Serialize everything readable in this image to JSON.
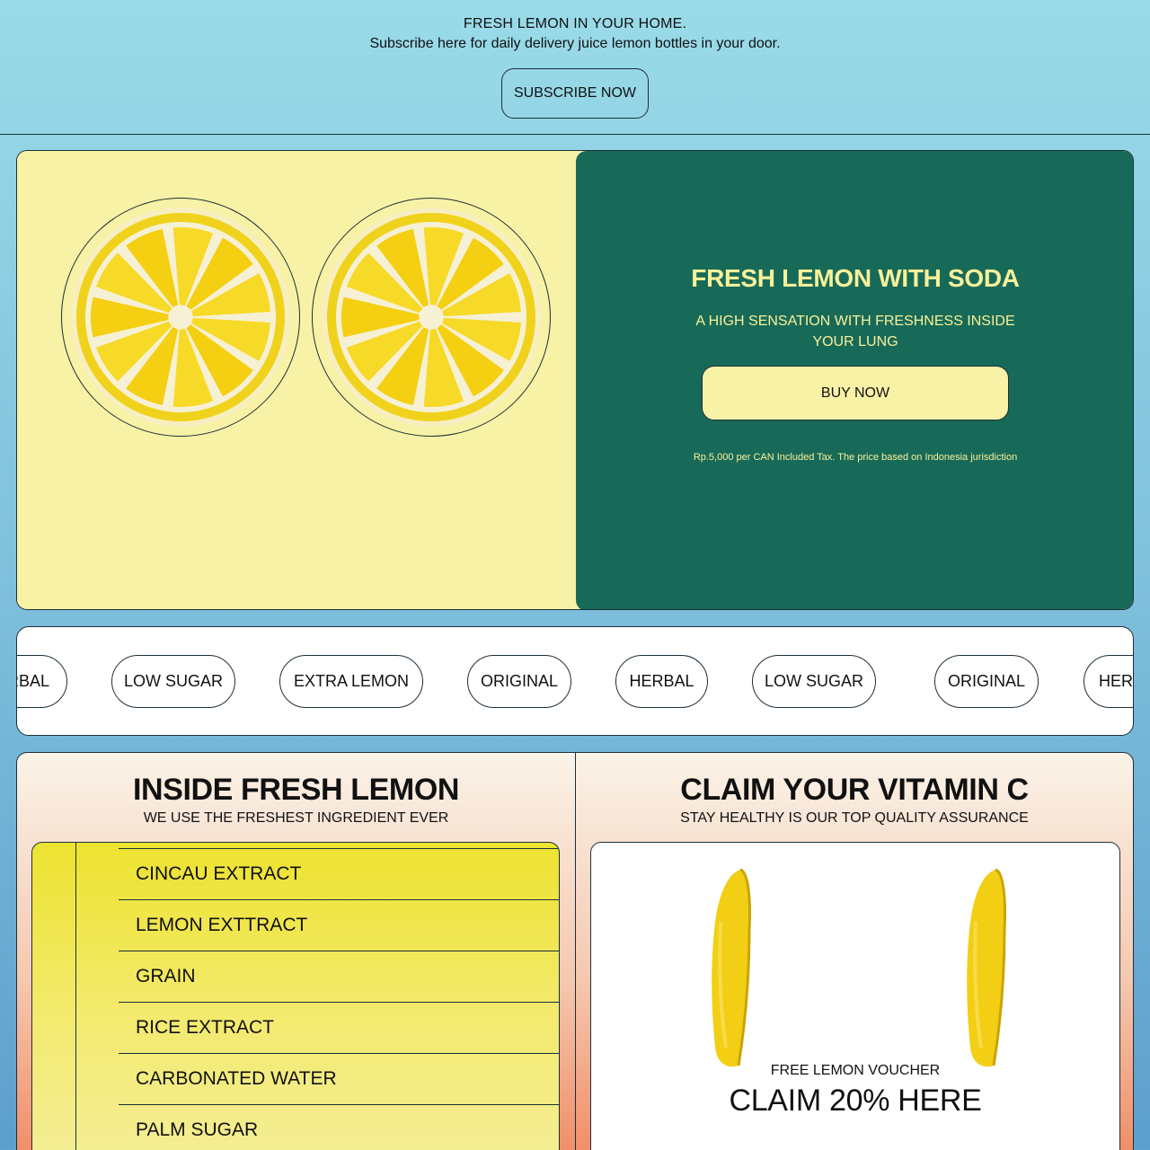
{
  "banner": {
    "headline": "FRESH LEMON IN YOUR HOME.",
    "subtext": "Subscribe here for daily delivery juice lemon bottles in your door.",
    "button_label": "SUBSCRIBE NOW"
  },
  "hero": {
    "title": "FRESH LEMON WITH SODA",
    "subtitle": "A HIGH SENSATION WITH FRESHNESS INSIDE YOUR LUNG",
    "button_label": "BUY NOW",
    "price_note": "Rp.5,000 per CAN Included Tax. The price based on Indonesia jurisdiction",
    "accent_color": "#186a58",
    "highlight_color": "#f8f09a"
  },
  "flavors": {
    "chips": [
      {
        "label": "HERBAL"
      },
      {
        "label": "LOW SUGAR"
      },
      {
        "label": "EXTRA LEMON"
      },
      {
        "label": "ORIGINAL"
      },
      {
        "label": "HERBAL"
      },
      {
        "label": "LOW SUGAR"
      },
      {
        "label": "ORIGINAL"
      },
      {
        "label": "HERBAL"
      }
    ]
  },
  "ingredients_panel": {
    "title": "INSIDE FRESH LEMON",
    "subtitle": "WE USE THE FRESHEST INGREDIENT EVER",
    "items": [
      {
        "label": "CINCAU EXTRACT"
      },
      {
        "label": "LEMON EXTTRACT"
      },
      {
        "label": "GRAIN"
      },
      {
        "label": "RICE EXTRACT"
      },
      {
        "label": "CARBONATED WATER"
      },
      {
        "label": "PALM SUGAR"
      }
    ]
  },
  "vitamin_panel": {
    "title": "CLAIM YOUR VITAMIN C",
    "subtitle": "STAY HEALTHY IS OUR TOP QUALITY ASSURANCE",
    "voucher_label": "FREE LEMON VOUCHER",
    "voucher_cta": "CLAIM 20% HERE"
  }
}
